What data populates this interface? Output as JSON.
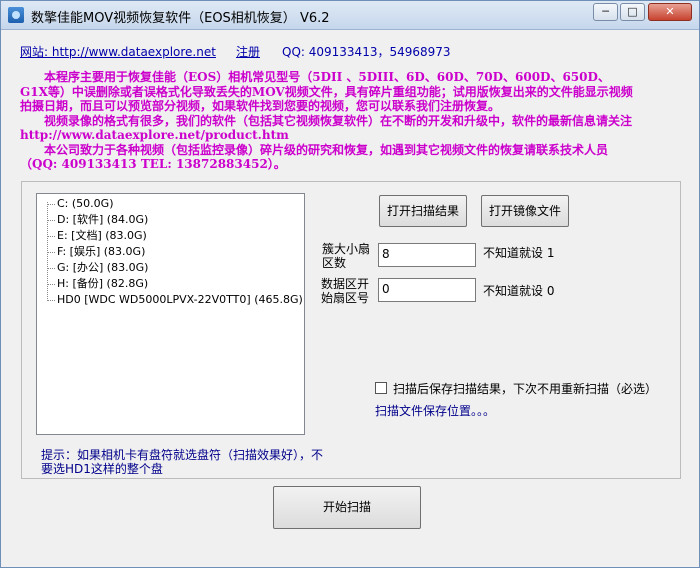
{
  "window": {
    "title": "数擎佳能MOV视频恢复软件（EOS相机恢复） V6.2",
    "min_glyph": "─",
    "max_glyph": "□",
    "close_glyph": "✕"
  },
  "links": {
    "site": "网站: http://www.dataexplore.net",
    "register": "注册",
    "qq": "QQ: 409133413，54968973"
  },
  "intro": {
    "p1": "本程序主要用于恢复佳能（EOS）相机常见型号（5DII 、5DIII、6D、60D、70D、600D、650D、G1X等）中误删除或者误格式化导致丢失的MOV视频文件，具有碎片重组功能；试用版恢复出来的文件能显示视频拍摄日期，而且可以预览部分视频，如果软件找到您要的视频，您可以联系我们注册恢复。",
    "p2": "视频录像的格式有很多，我们的软件（包括其它视频恢复软件）在不断的开发和升级中，软件的最新信息请关注 http://www.dataexplore.net/product.htm",
    "p3": "本公司致力于各种视频（包括监控录像）碎片级的研究和恢复，如遇到其它视频文件的恢复请联系技术人员（QQ: 409133413 TEL: 13872883452）。"
  },
  "drives": [
    {
      "label": "C:    (50.0G)"
    },
    {
      "label": "D:   [软件]  (84.0G)"
    },
    {
      "label": "E:   [文档]  (83.0G)"
    },
    {
      "label": "F:   [娱乐]  (83.0G)"
    },
    {
      "label": "G:   [办公]  (83.0G)"
    },
    {
      "label": "H:   [备份]  (82.8G)"
    },
    {
      "label": "HD0   [WDC WD5000LPVX-22V0TT0]  (465.8G)"
    }
  ],
  "buttons": {
    "open_scan_result": "打开扫描结果",
    "open_image_file": "打开镜像文件",
    "start_scan": "开始扫描"
  },
  "fields": {
    "cluster_label": "簇大小扇区数",
    "cluster_value": "8",
    "cluster_hint": "不知道就设 1",
    "start_sector_label": "数据区开始扇区号",
    "start_sector_value": "0",
    "start_sector_hint": "不知道就设 0"
  },
  "options": {
    "save_result_checked": false,
    "save_result_label": "扫描后保存扫描结果，下次不用重新扫描（必选）",
    "save_location_link": "扫描文件保存位置。。。"
  },
  "tip": "提示：如果相机卡有盘符就选盘符（扫描效果好），不要选HD1这样的整个盘",
  "colors": {
    "intro_text": "#cc00cc",
    "link_text": "#0000aa",
    "hint_text": "#00008b"
  }
}
